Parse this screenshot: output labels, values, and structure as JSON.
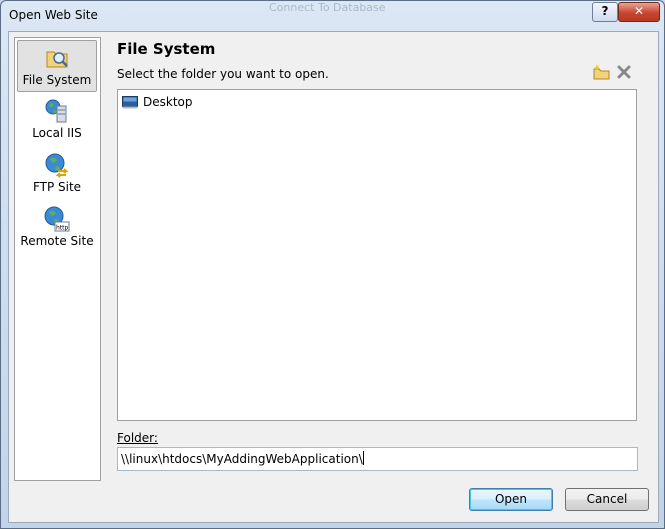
{
  "window": {
    "title": "Open Web Site",
    "background_title": "Connect To Database"
  },
  "titlebar_buttons": {
    "help": "?",
    "close": "✕"
  },
  "sidebar": {
    "items": [
      {
        "label": "File System",
        "icon": "file-system-icon",
        "selected": true
      },
      {
        "label": "Local IIS",
        "icon": "local-iis-icon",
        "selected": false
      },
      {
        "label": "FTP Site",
        "icon": "ftp-site-icon",
        "selected": false
      },
      {
        "label": "Remote Site",
        "icon": "remote-site-icon",
        "selected": false
      }
    ]
  },
  "main": {
    "heading": "File System",
    "instruction": "Select the folder you want to open.",
    "tree": {
      "items": [
        {
          "label": "Desktop",
          "icon": "desktop-icon"
        }
      ]
    },
    "folder_label": "Folder:",
    "folder_value": "\\\\linux\\htdocs\\MyAddingWebApplication\\"
  },
  "buttons": {
    "open": "Open",
    "cancel": "Cancel"
  },
  "colors": {
    "accent": "#3c7fb1",
    "close_red": "#c8452e"
  }
}
